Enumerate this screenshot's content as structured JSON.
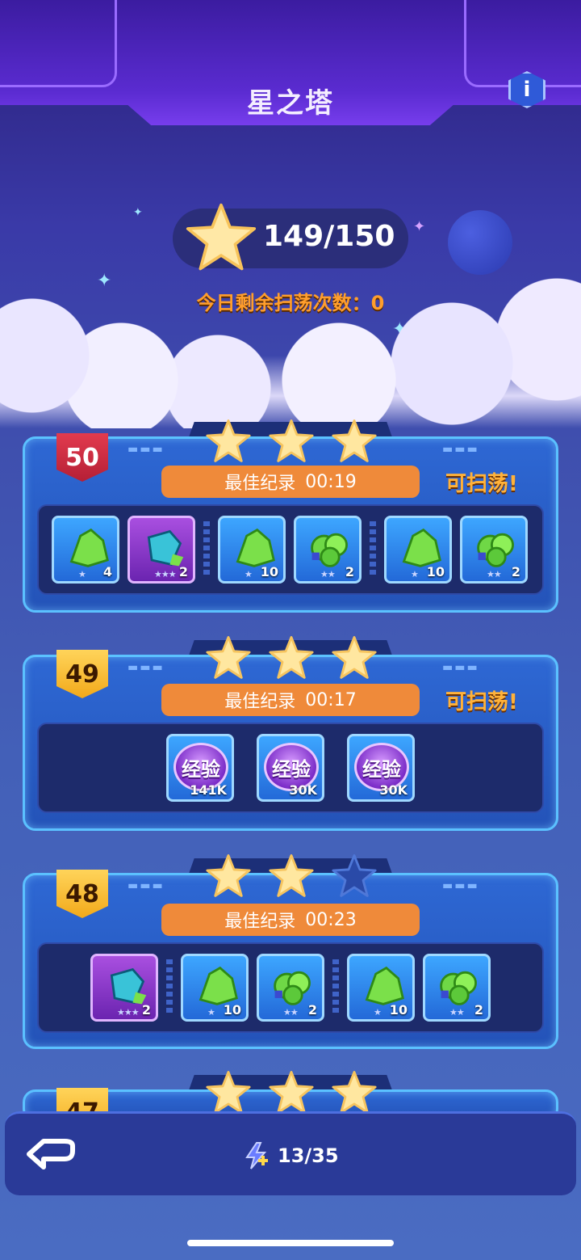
{
  "header": {
    "title": "星之塔",
    "info_label": "i"
  },
  "progress": {
    "stars": "149/150",
    "sweep_remaining": "今日剩余扫荡次数：0"
  },
  "levels": [
    {
      "level": "50",
      "stars": 3,
      "record_label": "最佳纪录",
      "record_time": "00:19",
      "sweepable": "可扫荡!",
      "rewards": [
        {
          "type": "green-ore",
          "qty": "4",
          "rarity": "★"
        },
        {
          "type": "blue-crystal",
          "qty": "2",
          "rarity": "★★★",
          "purple": true
        },
        {
          "sep": true
        },
        {
          "type": "green-ore",
          "qty": "10",
          "rarity": "★"
        },
        {
          "type": "green-gem-cluster",
          "qty": "2",
          "rarity": "★★"
        },
        {
          "sep": true
        },
        {
          "type": "green-ore",
          "qty": "10",
          "rarity": "★"
        },
        {
          "type": "green-gem-cluster",
          "qty": "2",
          "rarity": "★★"
        }
      ]
    },
    {
      "level": "49",
      "stars": 3,
      "record_label": "最佳纪录",
      "record_time": "00:17",
      "sweepable": "可扫荡!",
      "exp_rewards": [
        {
          "label": "经验",
          "qty": "141K"
        },
        {
          "label": "经验",
          "qty": "30K"
        },
        {
          "label": "经验",
          "qty": "30K"
        }
      ]
    },
    {
      "level": "48",
      "stars": 2,
      "record_label": "最佳纪录",
      "record_time": "00:23",
      "rewards": [
        {
          "type": "blue-crystal",
          "qty": "2",
          "rarity": "★★★",
          "purple": true
        },
        {
          "sep": true
        },
        {
          "type": "green-ore",
          "qty": "10",
          "rarity": "★"
        },
        {
          "type": "green-gem-cluster",
          "qty": "2",
          "rarity": "★★"
        },
        {
          "sep": true
        },
        {
          "type": "green-ore",
          "qty": "10",
          "rarity": "★"
        },
        {
          "type": "green-gem-cluster",
          "qty": "2",
          "rarity": "★★"
        }
      ]
    },
    {
      "level": "47",
      "stars": 3
    }
  ],
  "bottom": {
    "energy": "13/35"
  },
  "colors": {
    "accent_orange": "#ef8a3a",
    "sweep_text": "#ffb23a",
    "star_gold": "#ffe7a0"
  }
}
